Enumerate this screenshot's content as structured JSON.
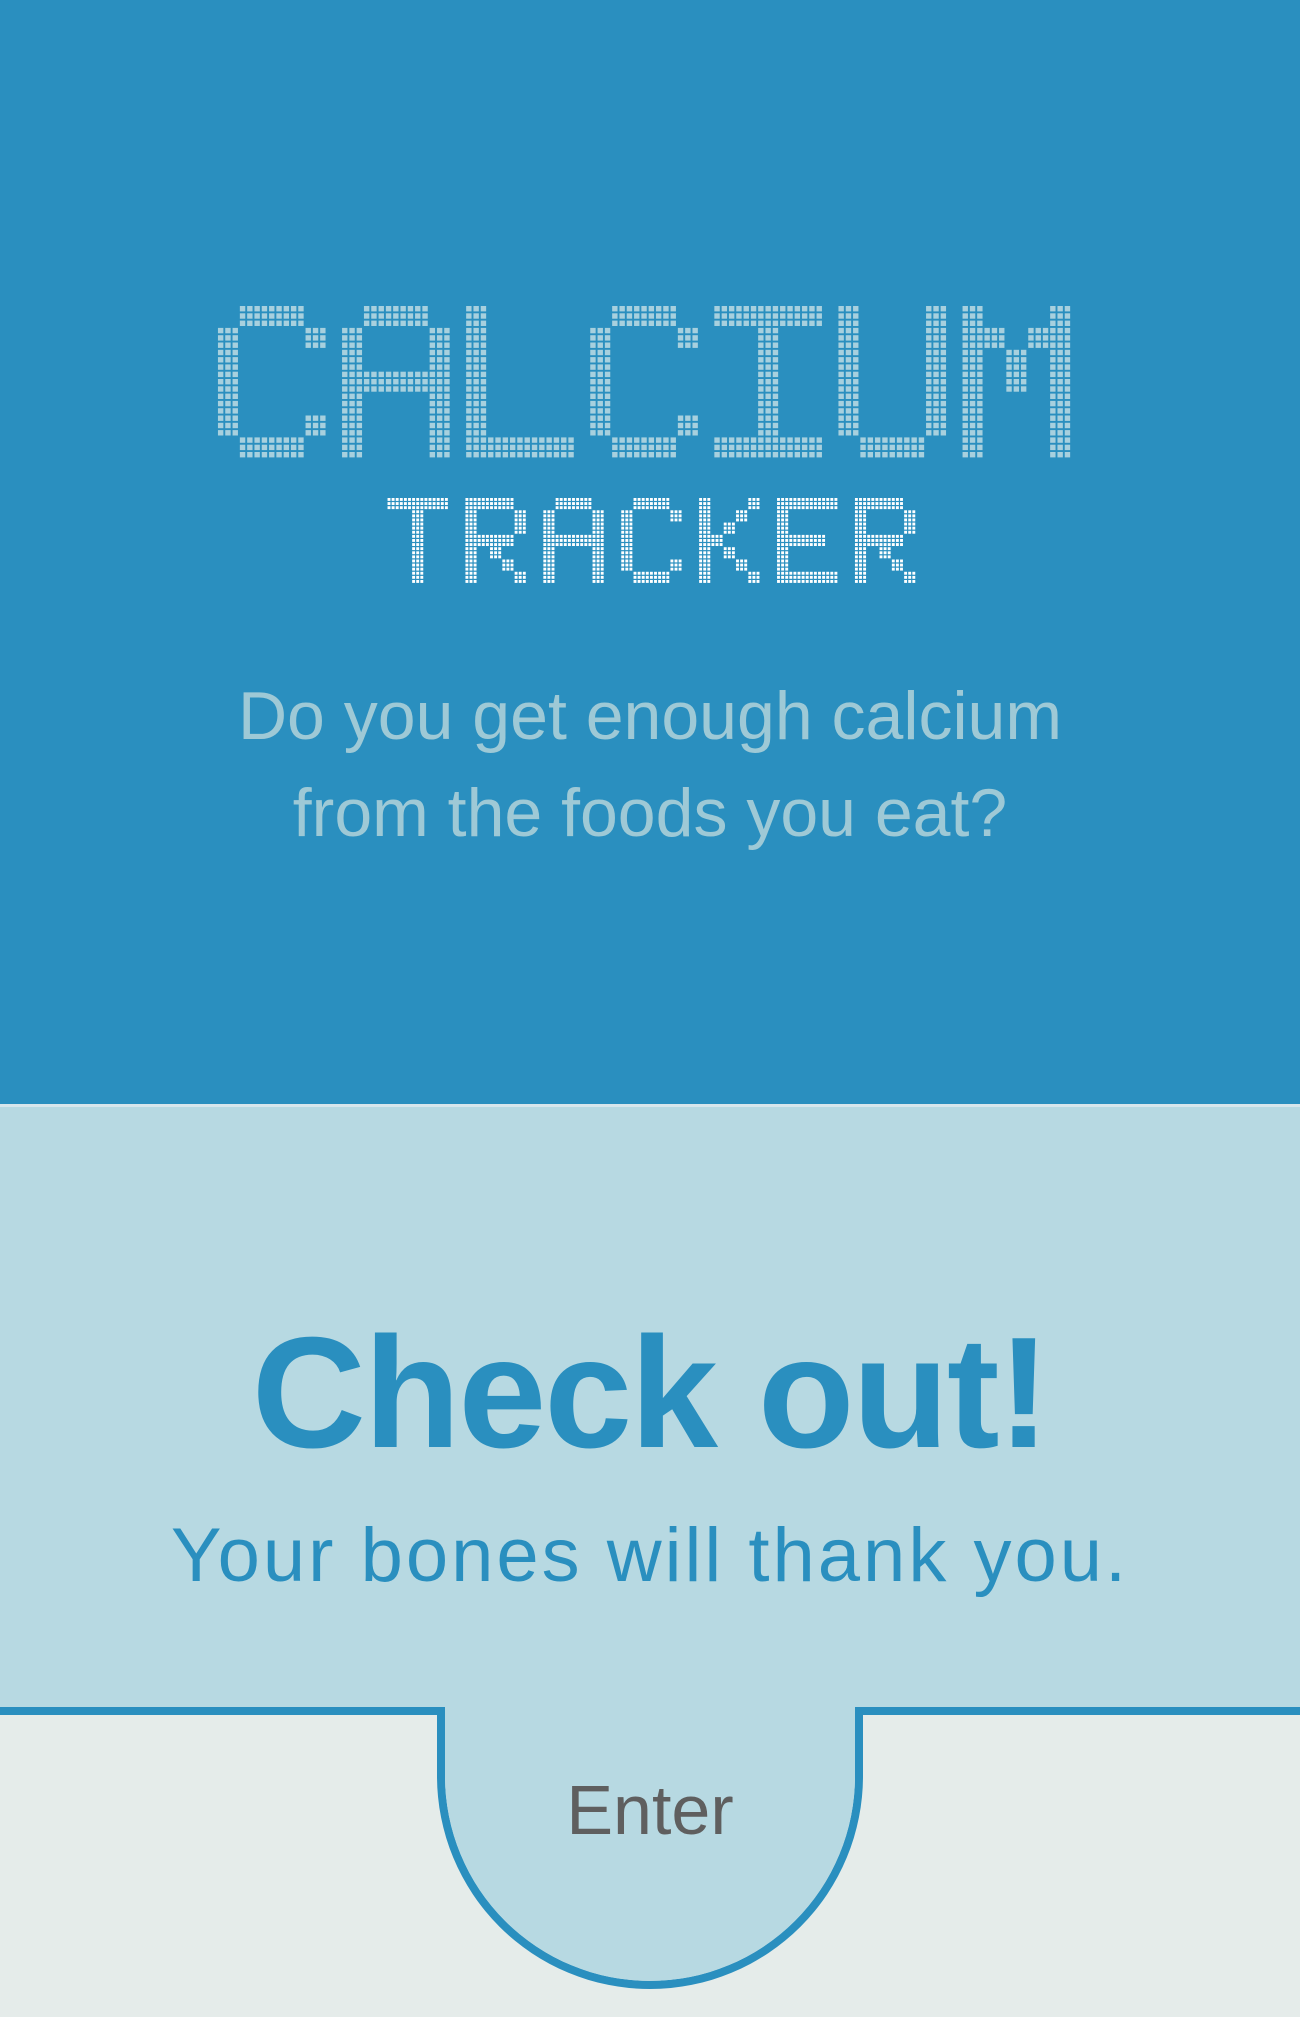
{
  "title": {
    "line1": "CALCIUM",
    "line2": "TRACKER"
  },
  "subtitle": {
    "line1": "Do you get enough calcium",
    "line2": "from the foods you eat?"
  },
  "promo": {
    "headline": "Check out!",
    "tagline": "Your bones will thank you."
  },
  "enter_button": {
    "label": "Enter"
  },
  "colors": {
    "primary_blue": "#2a8fbf",
    "light_blue": "#b7d9e2",
    "title_line1": "#a7d0de",
    "title_line2": "#ffffff",
    "subtitle_text": "#9ec9d6",
    "background_bottom": "#e5ecea",
    "button_text": "#5f5f5f"
  }
}
